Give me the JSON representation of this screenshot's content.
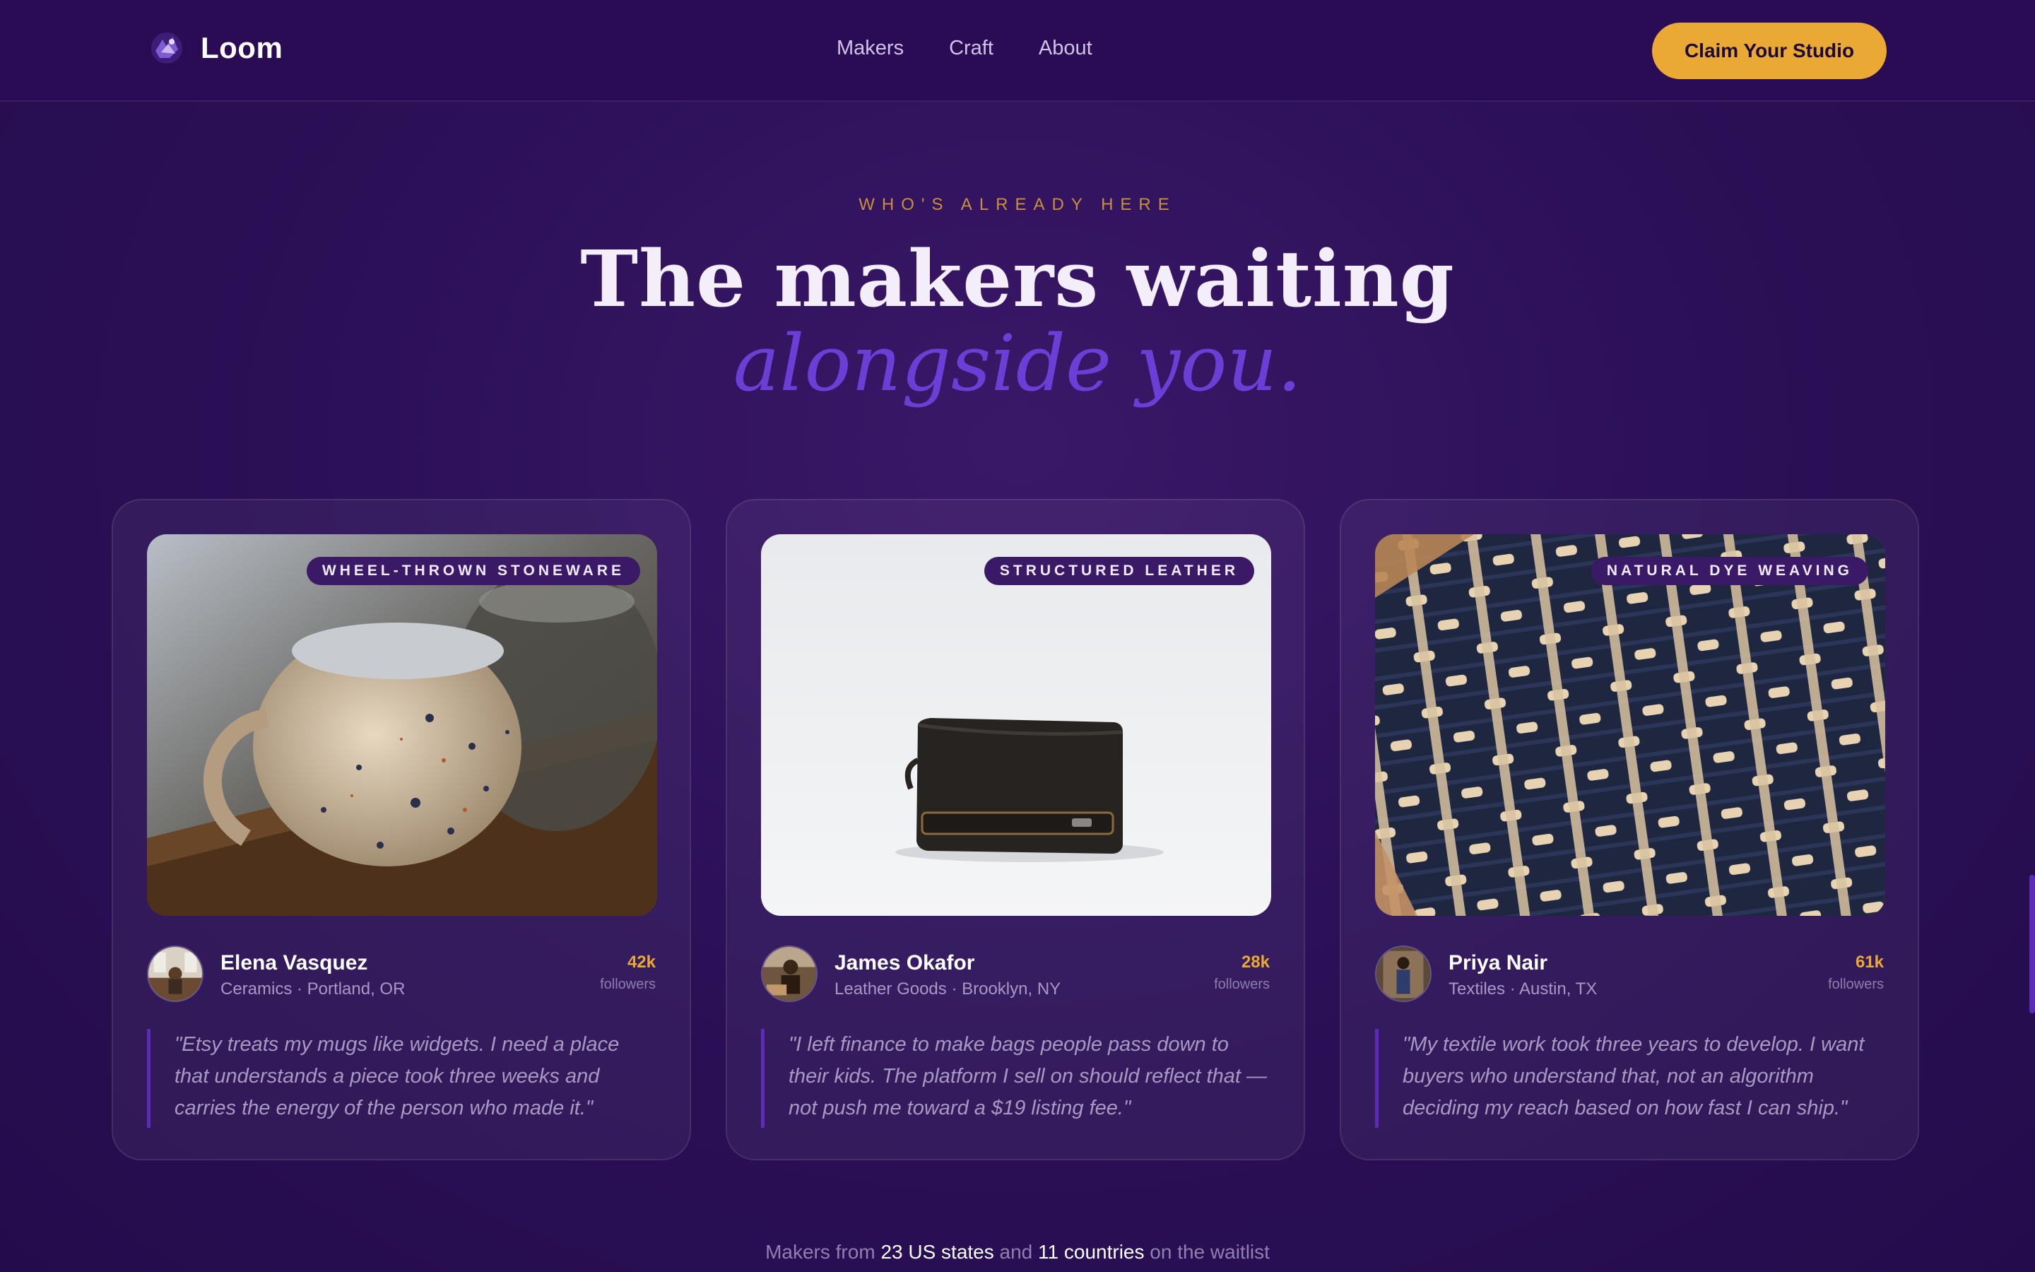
{
  "nav": {
    "brand": "Loom",
    "links": [
      "Makers",
      "Craft",
      "About"
    ],
    "cta": "Claim Your Studio"
  },
  "hero": {
    "eyebrow": "WHO'S ALREADY HERE",
    "title_line1": "The makers waiting",
    "title_line2": "alongside you."
  },
  "makers": [
    {
      "tag": "WHEEL-THROWN STONEWARE",
      "name": "Elena Vasquez",
      "meta": "Ceramics · Portland, OR",
      "followers": "42k",
      "followers_label": "followers",
      "quote": "\"Etsy treats my mugs like widgets. I need a place that understands a piece took three weeks and carries the energy of the person who made it.\""
    },
    {
      "tag": "STRUCTURED LEATHER",
      "name": "James Okafor",
      "meta": "Leather Goods · Brooklyn, NY",
      "followers": "28k",
      "followers_label": "followers",
      "quote": "\"I left finance to make bags people pass down to their kids. The platform I sell on should reflect that — not push me toward a $19 listing fee.\""
    },
    {
      "tag": "NATURAL DYE WEAVING",
      "name": "Priya Nair",
      "meta": "Textiles · Austin, TX",
      "followers": "61k",
      "followers_label": "followers",
      "quote": "\"My textile work took three years to develop. I want buyers who understand that, not an algorithm deciding my reach based on how fast I can ship.\""
    }
  ],
  "footnote": {
    "prefix": "Makers from",
    "states": "23 US states",
    "joiner": "and",
    "countries": "11 countries",
    "suffix": "on the waitlist"
  },
  "colors": {
    "background": "#2c1058",
    "accent_gold": "#e9a934",
    "accent_purple": "#6b3fd6"
  },
  "icons": [
    "loom-logo-icon"
  ]
}
